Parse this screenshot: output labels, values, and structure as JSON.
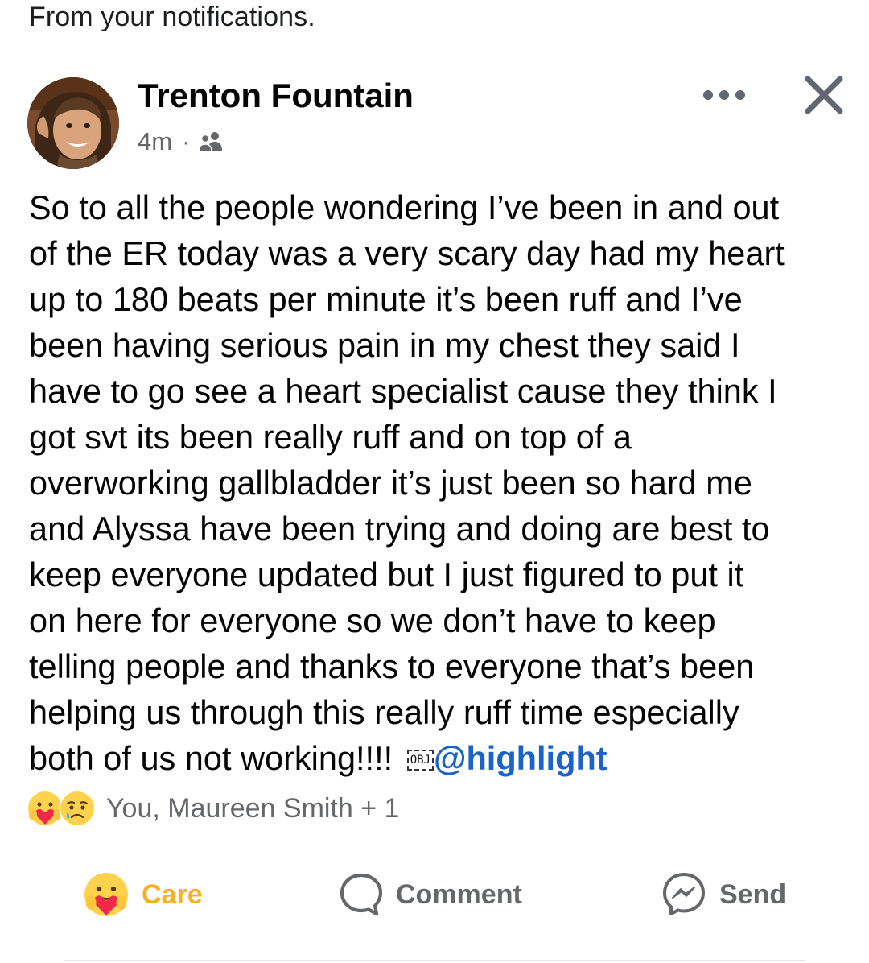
{
  "notice": "From your notifications.",
  "post": {
    "author": "Trenton Fountain",
    "time": "4m",
    "separator": "·",
    "audience_icon": "friends-icon",
    "lines": [
      "So to all the people wondering I’ve been in and out",
      "of the ER today was a very scary day had my heart",
      "up to 180 beats per minute it’s been ruff and I’ve",
      "been having serious pain in my chest they said I",
      "have to go see a heart specialist cause they think I",
      "got svt its been really ruff and on top of a",
      "overworking gallbladder it’s just been so hard me",
      "and Alyssa have been trying and doing are best to",
      "keep everyone updated but I just figured to put it",
      "on here for everyone so we don’t have to keep",
      "telling people and thanks to everyone that’s been",
      "helping us through this really ruff time especially"
    ],
    "last_line": "both of us not working!!!! ",
    "obj_placeholder": "OBJ",
    "mention": "@highlight"
  },
  "reactions": {
    "icons": [
      "care-emoji-icon",
      "sad-emoji-icon"
    ],
    "summary": "You, Maureen Smith + 1"
  },
  "actions": {
    "care": "Care",
    "comment": "Comment",
    "send": "Send"
  },
  "colors": {
    "care": "#f7b125",
    "mention": "#1b63c8",
    "secondary_text": "#65676b"
  }
}
